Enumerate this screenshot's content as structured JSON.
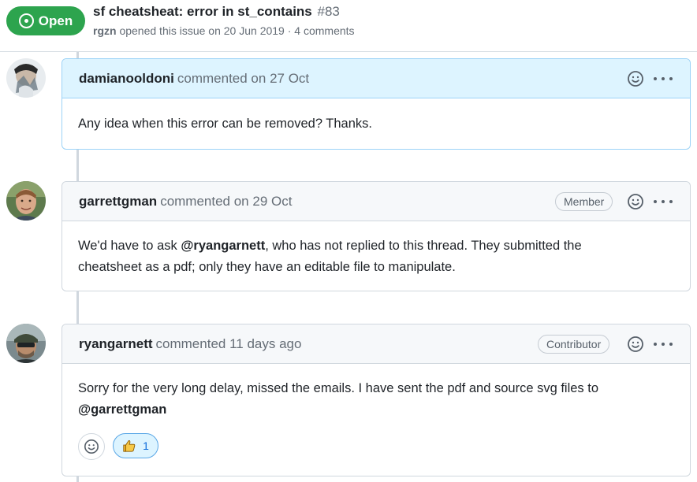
{
  "issue": {
    "state": "Open",
    "title": "sf cheatsheat: error in st_contains",
    "number": "#83",
    "author": "rgzn",
    "meta_text": " opened this issue on 20 Jun 2019 · 4 comments"
  },
  "comments": [
    {
      "author": "damianooldoni",
      "time": "commented on 27 Oct",
      "body": "Any idea when this error can be removed? Thanks."
    },
    {
      "author": "garrettgman",
      "time": "commented on 29 Oct",
      "badge": "Member",
      "body_pre": "We'd have to ask ",
      "mention": "@ryangarnett",
      "body_line1_post": ", who has not replied to this thread. They submitted the",
      "body_line2": "cheatsheet as a pdf; only they have an editable file to manipulate."
    },
    {
      "author": "ryangarnett",
      "time": "commented 11 days ago",
      "badge": "Contributor",
      "body_line1": "Sorry for the very long delay, missed the emails. I have sent the pdf and source svg files to",
      "mention": "@garrettgman",
      "reaction_count": "1"
    }
  ],
  "colors": {
    "open_green": "#2da44e",
    "highlight_blue": "#ddf4ff",
    "border": "#d0d7de"
  },
  "icons": [
    "smiley-icon",
    "kebab-icon",
    "issue-opened-icon",
    "thumbs-up-icon"
  ]
}
